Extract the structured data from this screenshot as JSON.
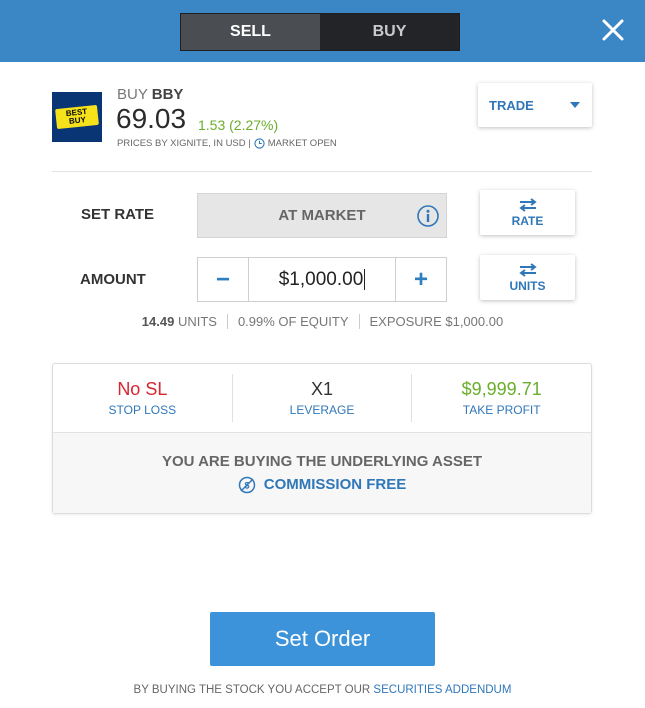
{
  "header": {
    "sell_label": "SELL",
    "buy_label": "BUY"
  },
  "instrument": {
    "logo_line1": "BEST",
    "logo_line2": "BUY",
    "action": "BUY",
    "symbol": "BBY",
    "price": "69.03",
    "change": "1.53 (2.27%)",
    "source": "PRICES BY XIGNITE, IN USD |",
    "market_status": "MARKET OPEN"
  },
  "trade_dropdown": {
    "label": "TRADE"
  },
  "rate": {
    "label": "SET RATE",
    "value": "AT MARKET",
    "toggle_label": "RATE"
  },
  "amount": {
    "label": "AMOUNT",
    "value": "$1,000.00",
    "toggle_label": "UNITS",
    "minus": "−",
    "plus": "+"
  },
  "meta": {
    "units_value": "14.49",
    "units_label": "UNITS",
    "equity": "0.99% OF EQUITY",
    "exposure": "EXPOSURE $1,000.00"
  },
  "params": [
    {
      "value": "No SL",
      "label": "STOP LOSS",
      "color": "#d6262f"
    },
    {
      "value": "X1",
      "label": "LEVERAGE",
      "color": "#333333"
    },
    {
      "value": "$9,999.71",
      "label": "TAKE PROFIT",
      "color": "#6aae2c"
    }
  ],
  "notice": {
    "underlying": "YOU ARE BUYING THE UNDERLYING ASSET",
    "commission": "COMMISSION FREE"
  },
  "set_order": {
    "label": "Set Order"
  },
  "footer": {
    "text": "BY BUYING THE STOCK YOU ACCEPT OUR",
    "link": "SECURITIES ADDENDUM"
  }
}
